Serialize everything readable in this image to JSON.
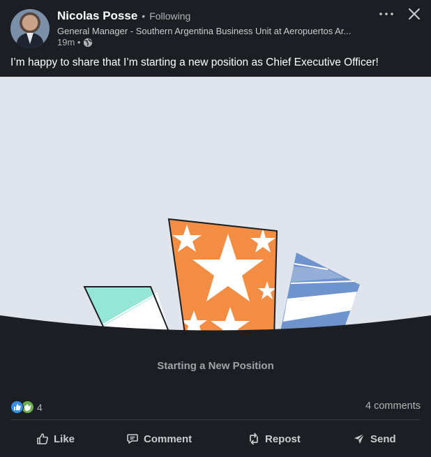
{
  "post": {
    "author_name": "Nicolas Posse",
    "separator": "•",
    "follow_status": "Following",
    "headline": "General Manager - Southern Argentina Business Unit at Aeropuertos Ar...",
    "time": "19m •",
    "text": "I’m happy to share that I’m starting a new position as Chief Executive Officer!"
  },
  "media": {
    "caption": "Starting a New Position",
    "colors": {
      "background": "#dfe4ed",
      "orange": "#f28d43",
      "teal": "#96e6d8",
      "blue": "#6f93cc",
      "dark": "#1b1f23"
    }
  },
  "social": {
    "reaction_count": "4",
    "comments": "4 comments"
  },
  "actions": {
    "like": "Like",
    "comment": "Comment",
    "repost": "Repost",
    "send": "Send"
  },
  "icons": [
    "globe-icon",
    "more-icon",
    "close-icon",
    "like-icon",
    "comment-icon",
    "repost-icon",
    "send-icon"
  ]
}
